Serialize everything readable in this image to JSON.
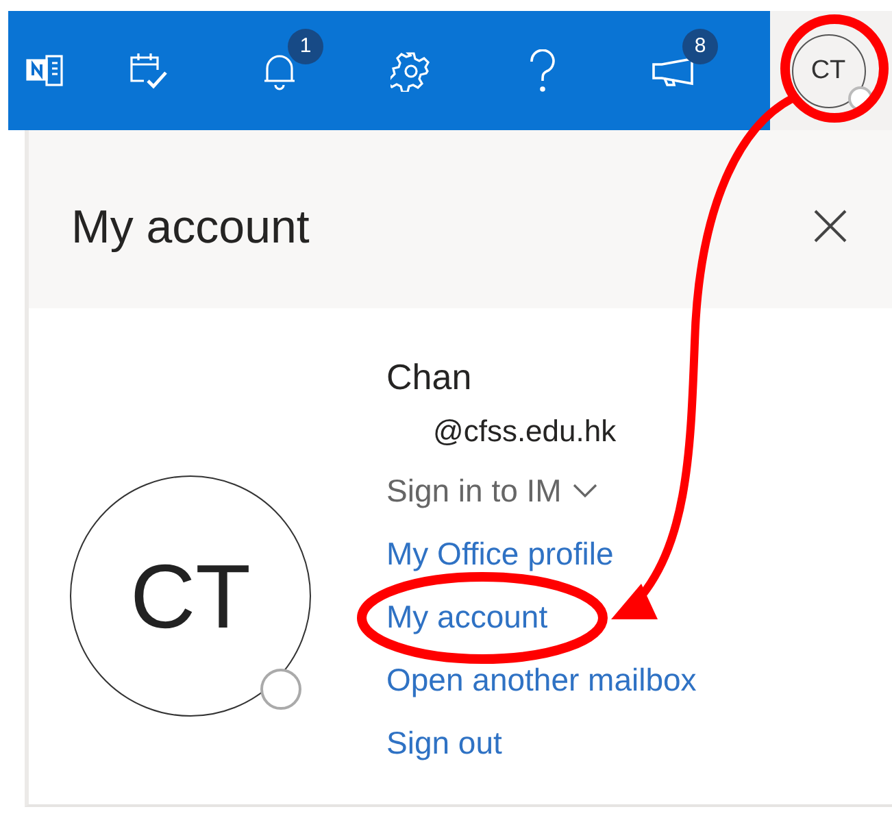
{
  "top_bar": {
    "icons": [
      {
        "kind": "onenote"
      },
      {
        "kind": "calendar"
      },
      {
        "kind": "bell",
        "badge": "1"
      },
      {
        "kind": "gear"
      },
      {
        "kind": "help"
      },
      {
        "kind": "megaphone",
        "badge": "8"
      }
    ],
    "avatar_initials": "CT"
  },
  "panel": {
    "title": "My account",
    "avatar_initials": "CT",
    "user_name": "Chan",
    "email": "@cfss.edu.hk",
    "sign_in_im": "Sign in to IM",
    "links": [
      "My Office profile",
      "My account",
      "Open another mailbox",
      "Sign out"
    ]
  }
}
